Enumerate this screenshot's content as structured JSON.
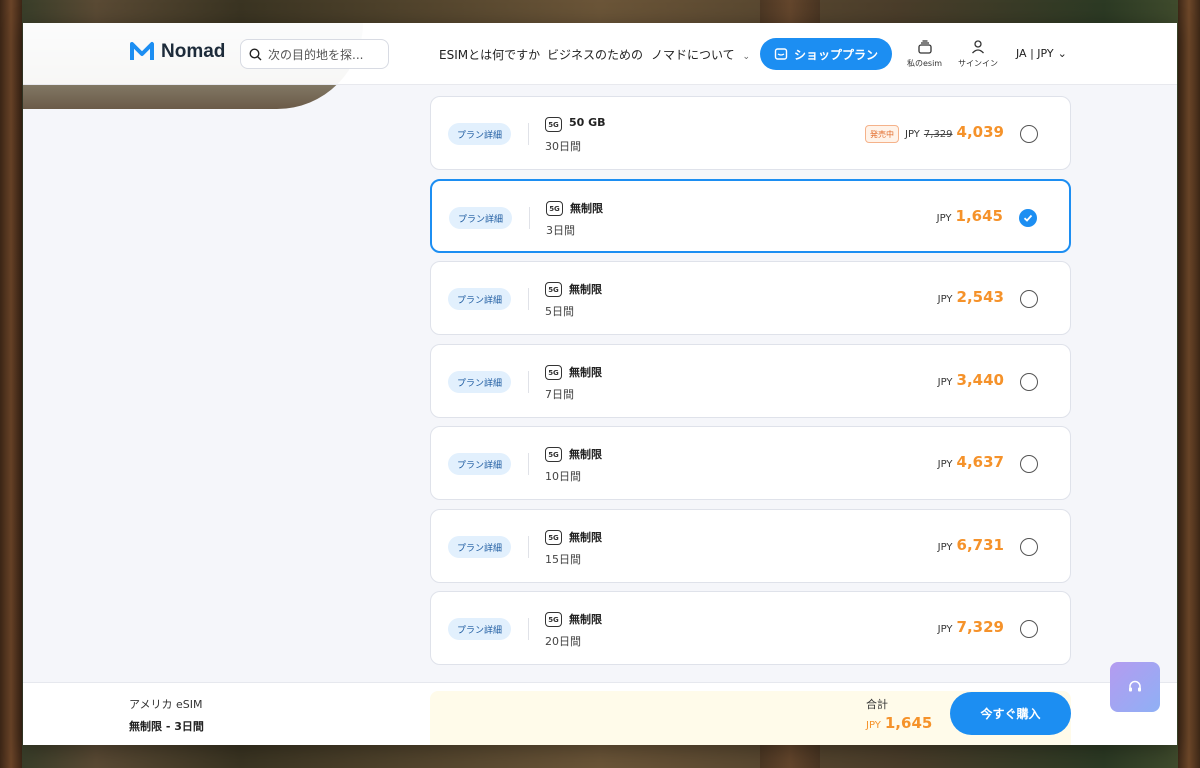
{
  "header": {
    "logo": "Nomad",
    "search_placeholder": "次の目的地を探...",
    "nav": [
      "ESIMとは何ですか",
      "ビジネスのための",
      "ノマドについて"
    ],
    "shop_button": "ショッププラン",
    "my_esim": "私のesim",
    "sign_in": "サインイン",
    "language": "JA | JPY"
  },
  "plans": [
    {
      "detail": "プラン詳細",
      "name": "50 GB",
      "days": "30日間",
      "sale": "発売中",
      "currency": "JPY",
      "old_price": "7,329",
      "price": "4,039",
      "selected": false
    },
    {
      "detail": "プラン詳細",
      "name": "無制限",
      "days": "3日間",
      "currency": "JPY",
      "price": "1,645",
      "selected": true
    },
    {
      "detail": "プラン詳細",
      "name": "無制限",
      "days": "5日間",
      "currency": "JPY",
      "price": "2,543",
      "selected": false
    },
    {
      "detail": "プラン詳細",
      "name": "無制限",
      "days": "7日間",
      "currency": "JPY",
      "price": "3,440",
      "selected": false
    },
    {
      "detail": "プラン詳細",
      "name": "無制限",
      "days": "10日間",
      "currency": "JPY",
      "price": "4,637",
      "selected": false
    },
    {
      "detail": "プラン詳細",
      "name": "無制限",
      "days": "15日間",
      "currency": "JPY",
      "price": "6,731",
      "selected": false
    },
    {
      "detail": "プラン詳細",
      "name": "無制限",
      "days": "20日間",
      "currency": "JPY",
      "price": "7,329",
      "selected": false
    }
  ],
  "network_badge": "5G",
  "bottom": {
    "title": "アメリカ eSIM",
    "subtitle": "無制限 - 3日間",
    "total_label": "合計",
    "currency": "JPY",
    "total": "1,645",
    "buy_button": "今すぐ購入"
  },
  "colors": {
    "accent": "#1c8ef2",
    "price": "#f5922a"
  }
}
